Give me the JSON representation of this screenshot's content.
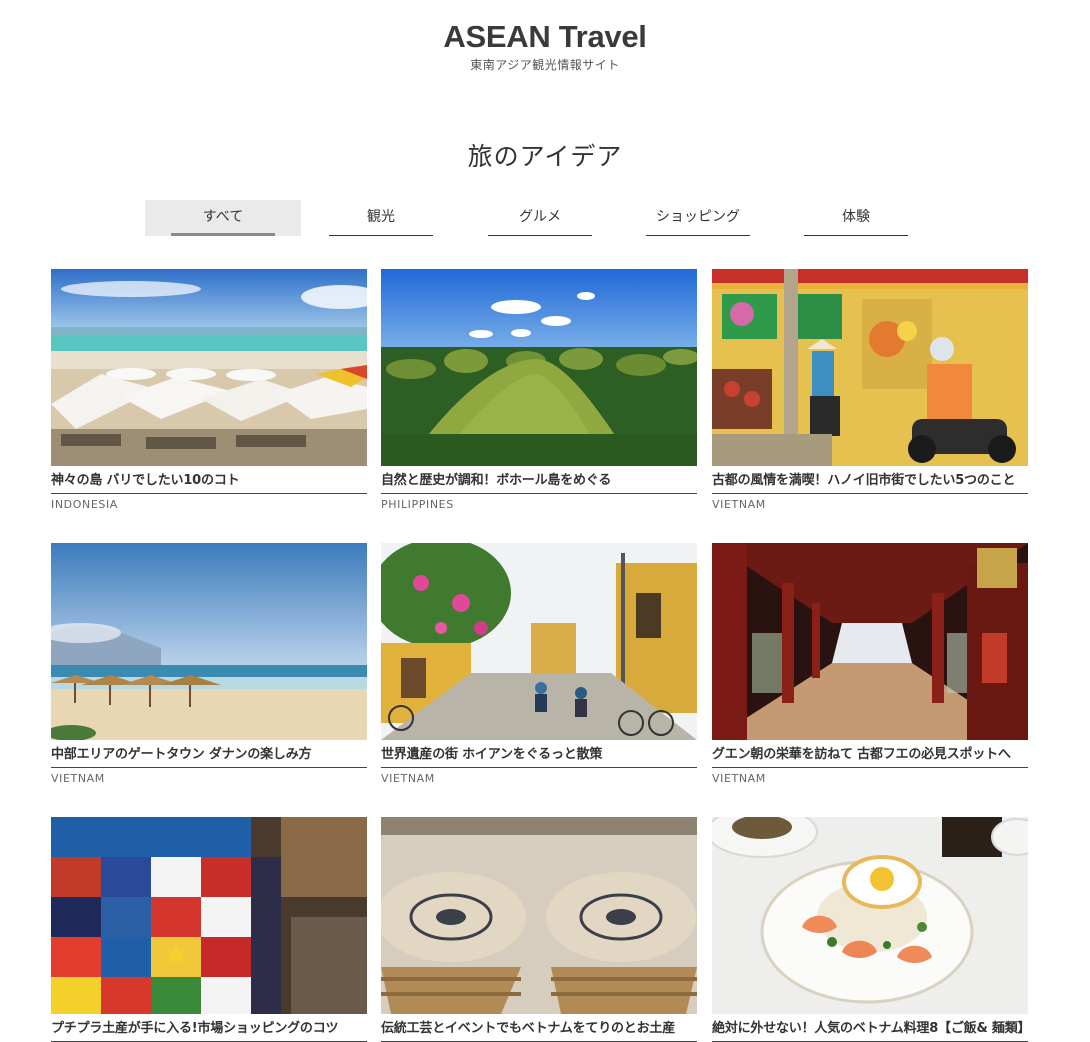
{
  "site": {
    "title": "ASEAN Travel",
    "subtitle": "東南アジア観光情報サイト"
  },
  "section": {
    "title": "旅のアイデア"
  },
  "tabs": [
    {
      "label": "すべて",
      "active": true
    },
    {
      "label": "観光",
      "active": false
    },
    {
      "label": "グルメ",
      "active": false
    },
    {
      "label": "ショッピング",
      "active": false
    },
    {
      "label": "体験",
      "active": false
    }
  ],
  "articles": [
    {
      "title": "神々の島 バリでしたい10のコト",
      "country": "INDONESIA",
      "image": "beach-umbrellas-photo"
    },
    {
      "title": "自然と歴史が調和！ボホール島をめぐる",
      "country": "PHILIPPINES",
      "image": "chocolate-hills-photo"
    },
    {
      "title": "古都の風情を満喫！ハノイ旧市街でしたい5つのこと",
      "country": "VIETNAM",
      "image": "hanoi-street-vendor-photo"
    },
    {
      "title": "中部エリアのゲートタウン ダナンの楽しみ方",
      "country": "VIETNAM",
      "image": "danang-beach-photo"
    },
    {
      "title": "世界遺産の街 ホイアンをぐるっと散策",
      "country": "VIETNAM",
      "image": "hoian-street-photo"
    },
    {
      "title": "グエン朝の栄華を訪ねて 古都フエの必見スポットへ",
      "country": "VIETNAM",
      "image": "hue-palace-corridor-photo"
    },
    {
      "title": "プチプラ土産が手に入る!市場ショッピングのコツ",
      "country": "",
      "image": "market-tshirts-photo"
    },
    {
      "title": "伝統工芸とイベントでもベトナムをてりのとお土産",
      "country": "",
      "image": "ceramic-bowls-photo"
    },
    {
      "title": "絶対に外せない！人気のベトナム料理8【ご飯& 麺類】",
      "country": "",
      "image": "shrimp-fried-rice-photo"
    }
  ],
  "colors": {
    "text": "#333333",
    "tab_active_bg": "#eaeaea",
    "tab_active_line": "#8a8a8a"
  }
}
